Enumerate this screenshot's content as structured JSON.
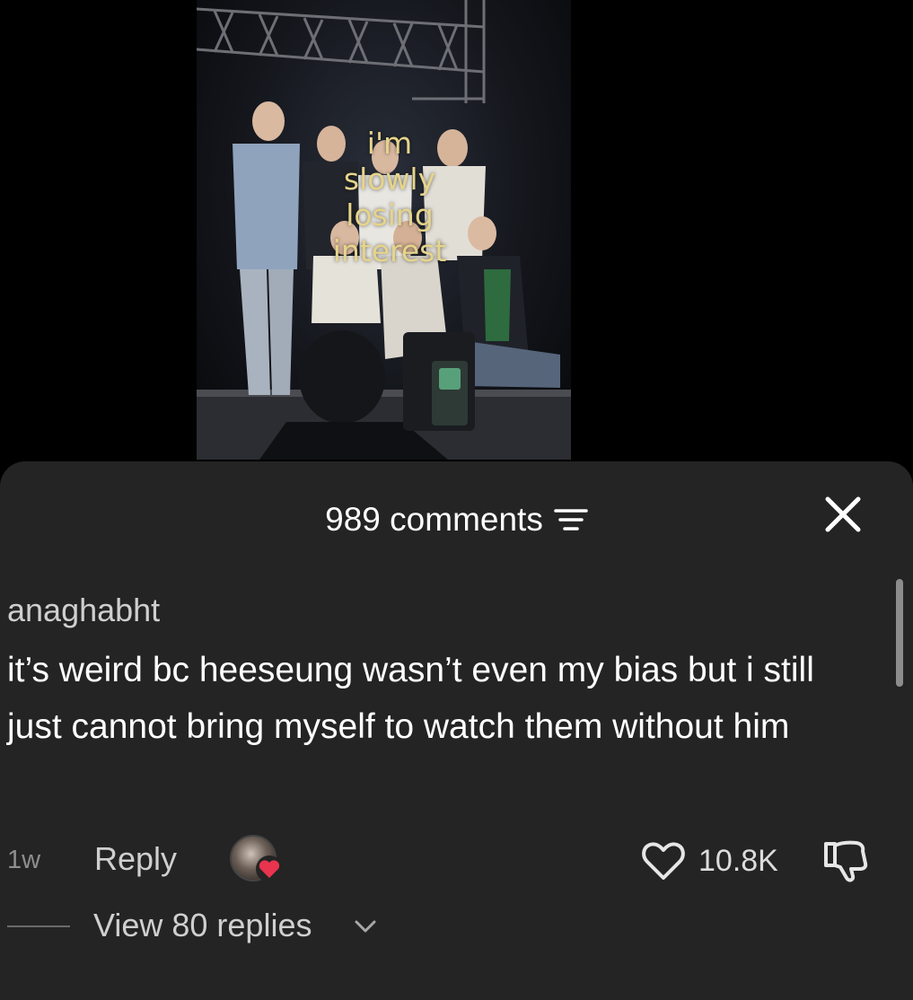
{
  "video": {
    "overlay_lines": [
      "i'm",
      "slowly",
      "losing",
      "interest"
    ]
  },
  "comments_header": {
    "count_label": "989 comments"
  },
  "comment": {
    "username": "anaghabht",
    "text": "it’s weird bc heeseung wasn’t even my bias but i still just cannot bring myself to watch them without him",
    "timestamp": "1w",
    "reply_label": "Reply",
    "like_count": "10.8K",
    "view_replies_label": "View 80 replies"
  },
  "colors": {
    "sheet_background": "#242424",
    "like_heart_accent": "#e8344e",
    "overlay_text": "#e6d48a"
  },
  "icons": [
    "filter-icon",
    "close-icon",
    "heart-icon",
    "dislike-icon",
    "chevron-down-icon"
  ]
}
